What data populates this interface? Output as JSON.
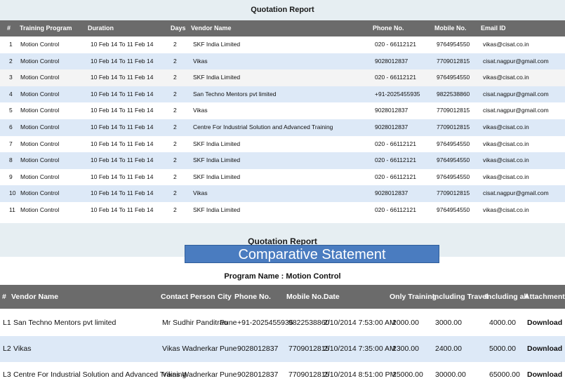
{
  "quotation_report": {
    "title": "Quotation Report",
    "headers": [
      "#",
      "Training Program",
      "Duration",
      "Days",
      "Vendor Name",
      "Phone No.",
      "Mobile No.",
      "Email ID"
    ],
    "rows": [
      [
        "1",
        "Motion Control",
        "10 Feb 14 To 11 Feb 14",
        "2",
        "SKF India Limited",
        "020 - 66112121",
        "9764954550",
        "vikas@cisat.co.in"
      ],
      [
        "2",
        "Motion Control",
        "10 Feb 14 To 11 Feb 14",
        "2",
        "Vikas",
        "9028012837",
        "7709012815",
        "cisat.nagpur@gmail.com"
      ],
      [
        "3",
        "Motion Control",
        "10 Feb 14 To 11 Feb 14",
        "2",
        "SKF India Limited",
        "020 - 66112121",
        "9764954550",
        "vikas@cisat.co.in"
      ],
      [
        "4",
        "Motion Control",
        "10 Feb 14 To 11 Feb 14",
        "2",
        "San Techno Mentors pvt limited",
        "+91-2025455935",
        "9822538860",
        "cisat.nagpur@gmail.com"
      ],
      [
        "5",
        "Motion Control",
        "10 Feb 14 To 11 Feb 14",
        "2",
        "Vikas",
        "9028012837",
        "7709012815",
        "cisat.nagpur@gmail.com"
      ],
      [
        "6",
        "Motion Control",
        "10 Feb 14 To 11 Feb 14",
        "2",
        "Centre For Industrial Solution and Advanced Training",
        "9028012837",
        "7709012815",
        "vikas@cisat.co.in"
      ],
      [
        "7",
        "Motion Control",
        "10 Feb 14 To 11 Feb 14",
        "2",
        "SKF India Limited",
        "020 - 66112121",
        "9764954550",
        "vikas@cisat.co.in"
      ],
      [
        "8",
        "Motion Control",
        "10 Feb 14 To 11 Feb 14",
        "2",
        "SKF India Limited",
        "020 - 66112121",
        "9764954550",
        "vikas@cisat.co.in"
      ],
      [
        "9",
        "Motion Control",
        "10 Feb 14 To 11 Feb 14",
        "2",
        "SKF India Limited",
        "020 - 66112121",
        "9764954550",
        "vikas@cisat.co.in"
      ],
      [
        "10",
        "Motion Control",
        "10 Feb 14 To 11 Feb 14",
        "2",
        "Vikas",
        "9028012837",
        "7709012815",
        "cisat.nagpur@gmail.com"
      ],
      [
        "11",
        "Motion Control",
        "10 Feb 14 To 11 Feb 14",
        "2",
        "SKF India Limited",
        "020 - 66112121",
        "9764954550",
        "vikas@cisat.co.in"
      ]
    ]
  },
  "comparative": {
    "report_title": "Quotation Report",
    "banner": "Comparative Statement",
    "program_label": "Program Name : Motion Control",
    "headers": [
      "#",
      "Vendor Name",
      "Contact Person",
      "City",
      "Phone No.",
      "Mobile No.",
      "Date",
      "Only Training",
      "Including Travel",
      "Including all",
      "Attachment"
    ],
    "rows": [
      [
        "L1",
        "San Techno Mentors pvt limited",
        "Mr Sudhir Panditrao",
        "Pune",
        "+91-2025455935",
        "9822538860",
        "2/10/2014 7:53:00 AM",
        "2000.00",
        "3000.00",
        "4000.00",
        "Download"
      ],
      [
        "L2",
        "Vikas",
        "Vikas Wadnerkar",
        "Pune",
        "9028012837",
        "7709012815",
        "2/10/2014 7:35:00 AM",
        "2300.00",
        "2400.00",
        "5000.00",
        "Download"
      ],
      [
        "L3",
        "Centre For Industrial Solution and Advanced Training",
        "Vikas Wadnerkar",
        "Pune",
        "9028012837",
        "7709012815",
        "2/10/2014 8:51:00 PM",
        "25000.00",
        "30000.00",
        "65000.00",
        "Download"
      ]
    ]
  }
}
